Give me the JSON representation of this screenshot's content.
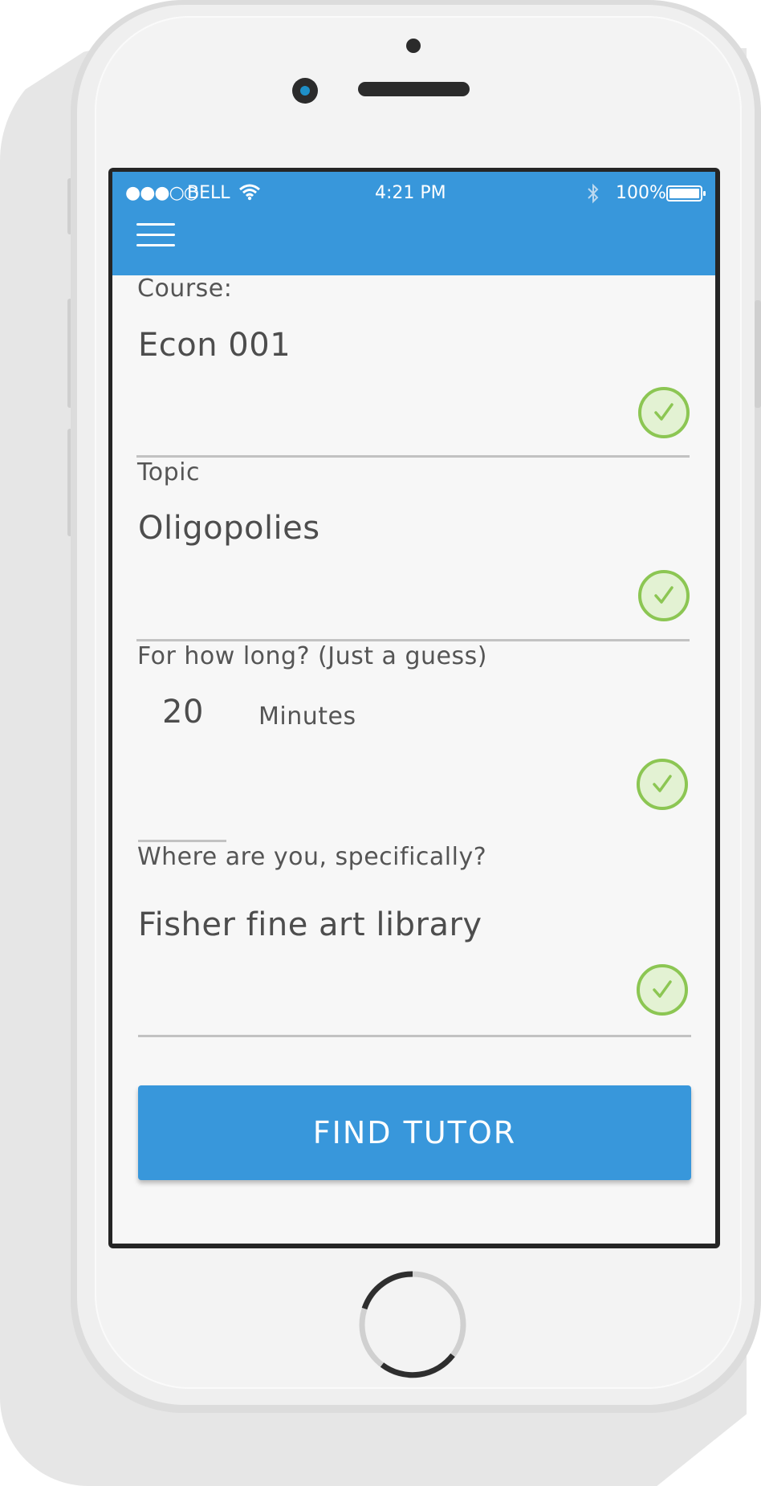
{
  "status_bar": {
    "signal": "●●●○○",
    "carrier": "BELL",
    "time": "4:21 PM",
    "battery_percent": "100%",
    "icons": [
      "wifi-icon",
      "bluetooth-icon",
      "battery-icon"
    ]
  },
  "header": {
    "menu_icon": "hamburger-menu-icon"
  },
  "form": {
    "course": {
      "label": "Course:",
      "value": "Econ 001",
      "valid": true
    },
    "topic": {
      "label": "Topic",
      "value": "Oligopolies",
      "valid": true
    },
    "duration": {
      "label": "For how long? (Just a guess)",
      "value": "20",
      "unit": "Minutes",
      "valid": true
    },
    "location": {
      "label": "Where are you, specifically?",
      "value": "Fisher fine art library",
      "valid": true
    }
  },
  "actions": {
    "find_tutor_label": "FIND TUTOR"
  },
  "colors": {
    "accent": "#3897db",
    "valid": "#8cc653",
    "text": "#4d4d4d"
  }
}
